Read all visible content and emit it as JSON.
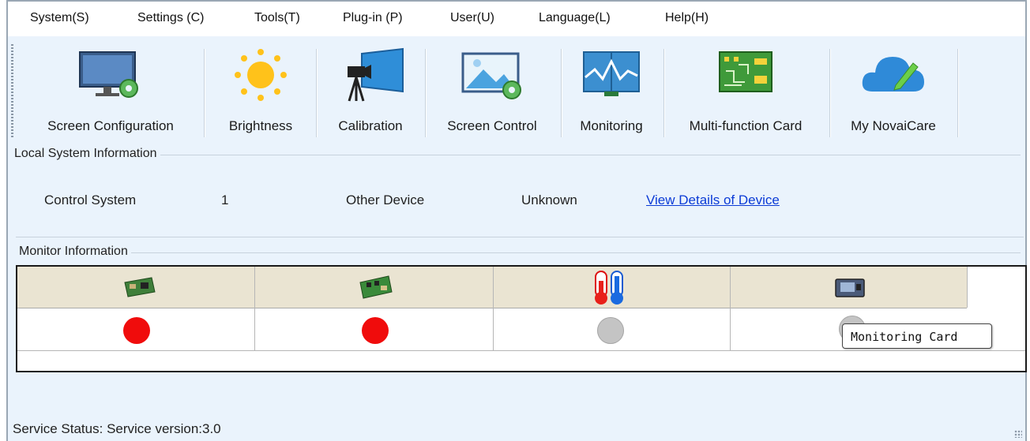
{
  "menu": [
    "System(S)",
    "Settings (C)",
    "Tools(T)",
    "Plug-in (P)",
    "User(U)",
    "Language(L)",
    "Help(H)"
  ],
  "toolbar": {
    "items": [
      {
        "label": "Screen Configuration",
        "icon": "monitor-gear-icon"
      },
      {
        "label": "Brightness",
        "icon": "sun-icon"
      },
      {
        "label": "Calibration",
        "icon": "camera-screen-icon"
      },
      {
        "label": "Screen Control",
        "icon": "screen-image-gear-icon"
      },
      {
        "label": "Monitoring",
        "icon": "waveform-monitor-icon"
      },
      {
        "label": "Multi-function Card",
        "icon": "circuit-board-icon"
      },
      {
        "label": "My NovaiCare",
        "icon": "cloud-pen-icon"
      }
    ]
  },
  "local_system": {
    "title": "Local System Information",
    "control_system_label": "Control System",
    "control_system_value": "1",
    "other_device_label": "Other Device",
    "other_device_value": "Unknown",
    "details_link": "View Details of Device"
  },
  "monitor": {
    "title": "Monitor Information",
    "columns": [
      {
        "icon": "sending-card-icon",
        "status": "error"
      },
      {
        "icon": "receiving-card-icon",
        "status": "error"
      },
      {
        "icon": "thermometer-icon",
        "status": "unknown"
      },
      {
        "icon": "monitoring-card-icon",
        "status": "unknown"
      }
    ],
    "status_colors": {
      "error": "#f00c0c",
      "unknown": "#c4c4c4"
    },
    "tooltip": "Monitoring Card"
  },
  "status_bar": {
    "label": "Service Status:",
    "value": "Service version:3.0"
  }
}
